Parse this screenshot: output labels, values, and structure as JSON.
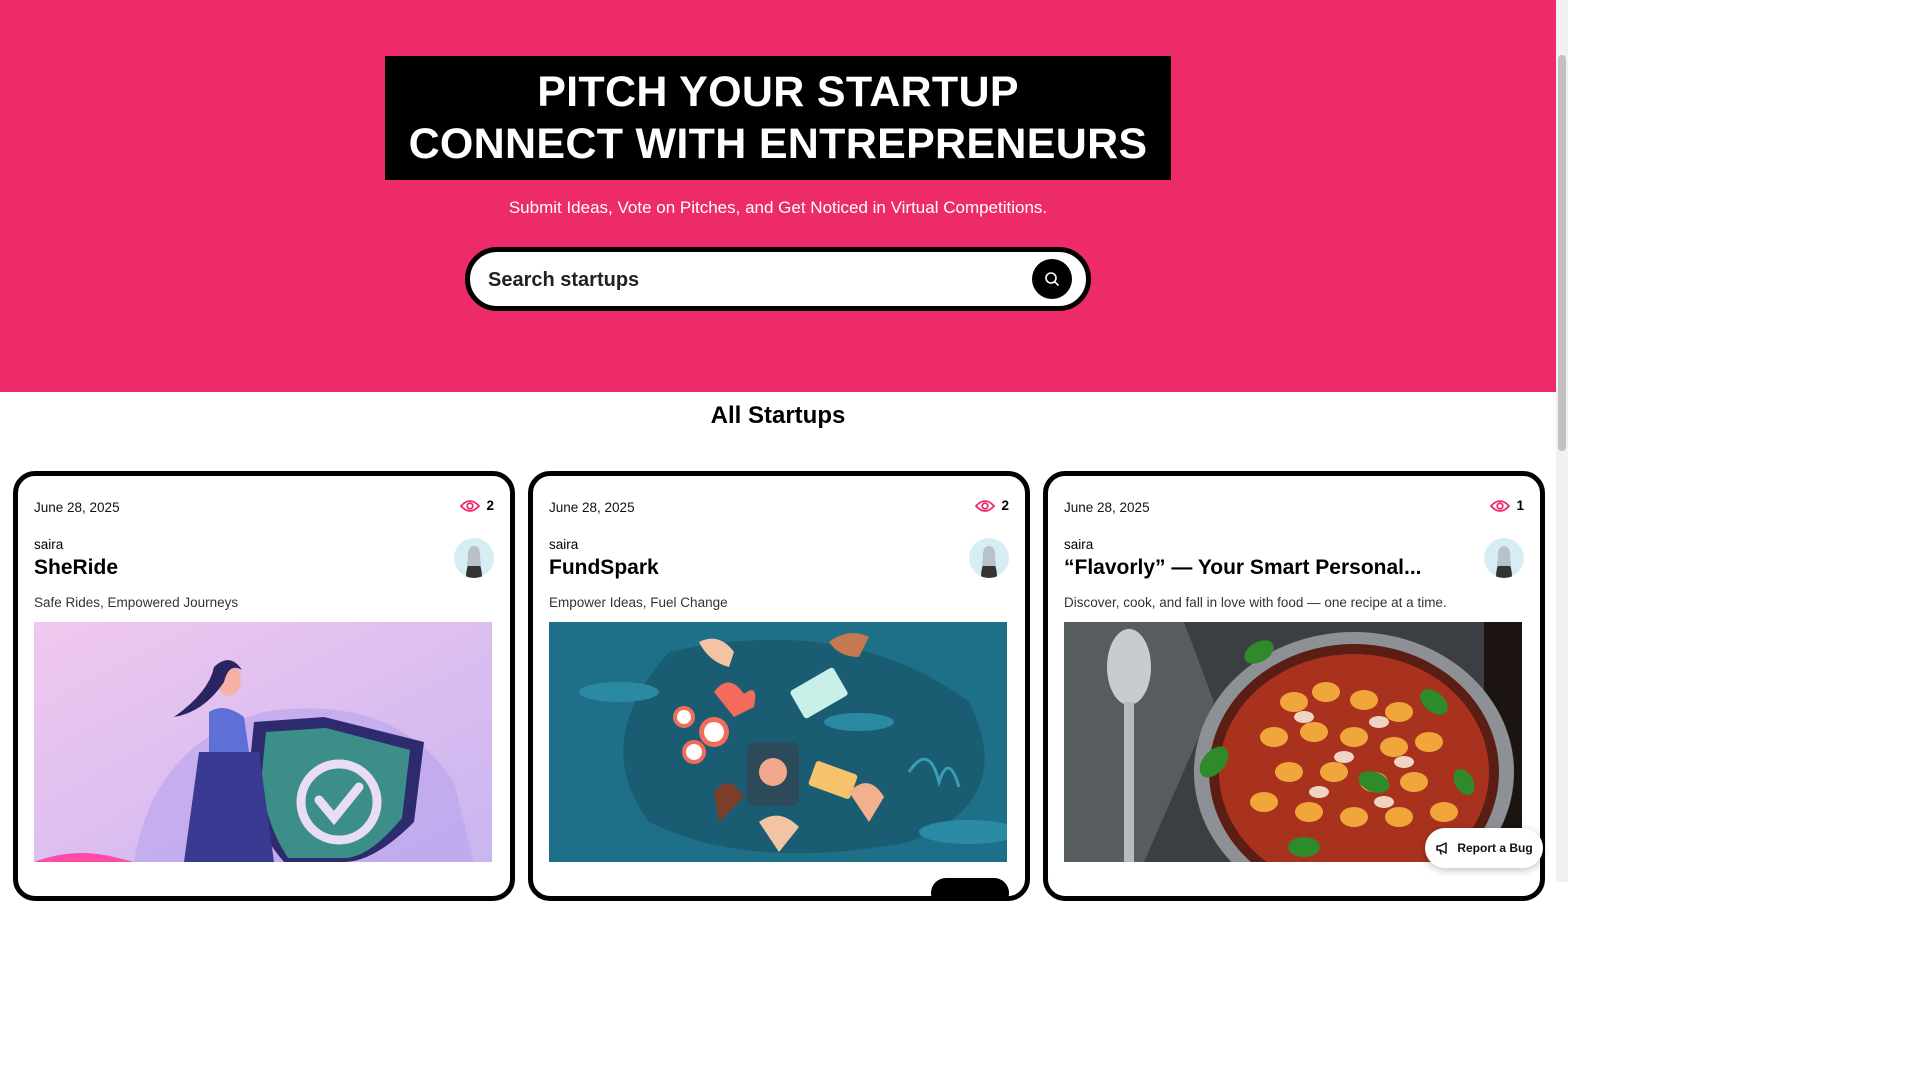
{
  "hero": {
    "title_line1": "PITCH YOUR STARTUP",
    "title_line2": "CONNECT WITH ENTREPRENEURS",
    "subtitle": "Submit Ideas, Vote on Pitches, and Get Noticed in Virtual Competitions.",
    "background_color": "#ee2b69"
  },
  "search": {
    "placeholder": "Search startups",
    "button_icon": "search-icon"
  },
  "section": {
    "title": "All Startups"
  },
  "startups": [
    {
      "date": "June 28, 2025",
      "views": "2",
      "author": "saira",
      "title": "SheRide",
      "description": "Safe Rides, Empowered Journeys",
      "image": "woman-with-shield-illustration"
    },
    {
      "date": "June 28, 2025",
      "views": "2",
      "author": "saira",
      "title": "FundSpark",
      "description": "Empower Ideas, Fuel Change",
      "image": "hands-with-money-illustration"
    },
    {
      "date": "June 28, 2025",
      "views": "1",
      "author": "saira",
      "title": "“Flavorly” — Your Smart Personal...",
      "description": "Discover, cook, and fall in love with food — one recipe at a time.",
      "image": "gnocchi-pan-photo"
    }
  ],
  "report_bug": {
    "label": "Report a Bug",
    "icon": "megaphone-icon"
  }
}
